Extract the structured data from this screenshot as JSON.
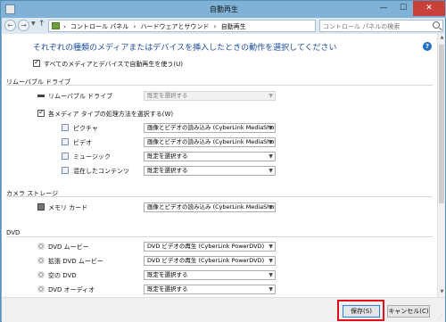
{
  "window": {
    "title": "自動再生",
    "minimize": "—",
    "maximize": "☐",
    "close": "✕"
  },
  "address": {
    "back": "←",
    "forward": "→",
    "up": "↑",
    "crumbs": [
      "›",
      "コントロール パネル",
      "›",
      "ハードウェアとサウンド",
      "›",
      "自動再生"
    ],
    "refresh": "↻",
    "search_placeholder": "コントロール パネルの検索"
  },
  "heading": "それぞれの種類のメディアまたはデバイスを挿入したときの動作を選択してください",
  "help": "?",
  "use_autoplay": {
    "label": "すべてのメディアとデバイスで自動再生を使う(U)",
    "checked": true
  },
  "removable": {
    "title": "リムーバブル ドライブ",
    "drive_label": "リムーバブル ドライブ",
    "drive_value": "既定を選択する",
    "choose_each": {
      "label": "各メディア タイプの処理方法を選択する(W)",
      "checked": true
    },
    "items": [
      {
        "label": "ピクチャ",
        "value": "画像とビデオの読み込み (CyberLink MediaShow)",
        "enabled": true
      },
      {
        "label": "ビデオ",
        "value": "画像とビデオの読み込み (CyberLink MediaShow)",
        "enabled": true
      },
      {
        "label": "ミュージック",
        "value": "既定を選択する",
        "enabled": true
      },
      {
        "label": "混在したコンテンツ",
        "value": "既定を選択する",
        "enabled": true
      }
    ]
  },
  "camera": {
    "title": "カメラ ストレージ",
    "items": [
      {
        "label": "メモリ カード",
        "value": "画像とビデオの読み込み (CyberLink MediaShow)",
        "enabled": true
      }
    ]
  },
  "dvd": {
    "title": "DVD",
    "items": [
      {
        "label": "DVD ムービー",
        "value": "DVD ビデオの再生 (CyberLink PowerDVD)",
        "enabled": true
      },
      {
        "label": "拡張 DVD ムービー",
        "value": "DVD ビデオの再生 (CyberLink PowerDVD)",
        "enabled": true
      },
      {
        "label": "空の DVD",
        "value": "既定を選択する",
        "enabled": true
      },
      {
        "label": "DVD オーディオ",
        "value": "既定を選択する",
        "enabled": true
      }
    ]
  },
  "footer": {
    "save": "保存(S)",
    "cancel": "キャンセル(C)"
  },
  "colors": {
    "heading": "#1e4e9c",
    "highlight": "#e0101a",
    "titlebar": "#7fb2d6"
  }
}
